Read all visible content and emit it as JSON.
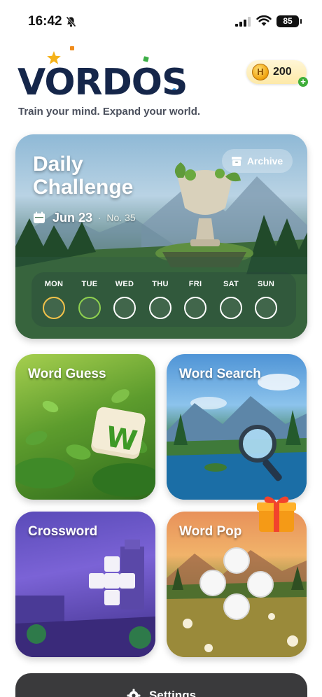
{
  "status_bar": {
    "time": "16:42",
    "battery": "85"
  },
  "header": {
    "logo_text": "VORDOS",
    "tagline": "Train your mind. Expand your world.",
    "coins": "200",
    "coin_symbol": "H",
    "coin_add_symbol": "+"
  },
  "daily_challenge": {
    "title_line1": "Daily",
    "title_line2": "Challenge",
    "date": "Jun 23",
    "separator": "·",
    "number": "No. 35",
    "archive_label": "Archive",
    "days": [
      {
        "label": "MON",
        "state": "in-progress",
        "color": "#f2c24a"
      },
      {
        "label": "TUE",
        "state": "complete",
        "color": "#8fd14f"
      },
      {
        "label": "WED",
        "state": "empty",
        "color": "#ffffff"
      },
      {
        "label": "THU",
        "state": "empty",
        "color": "#ffffff"
      },
      {
        "label": "FRI",
        "state": "empty",
        "color": "#ffffff"
      },
      {
        "label": "SAT",
        "state": "empty",
        "color": "#ffffff"
      },
      {
        "label": "SUN",
        "state": "empty",
        "color": "#ffffff"
      }
    ]
  },
  "games": {
    "word_guess": {
      "label": "Word Guess",
      "tile_letter": "W"
    },
    "word_search": {
      "label": "Word Search"
    },
    "crossword": {
      "label": "Crossword"
    },
    "word_pop": {
      "label": "Word Pop"
    }
  },
  "settings": {
    "label": "Settings"
  }
}
